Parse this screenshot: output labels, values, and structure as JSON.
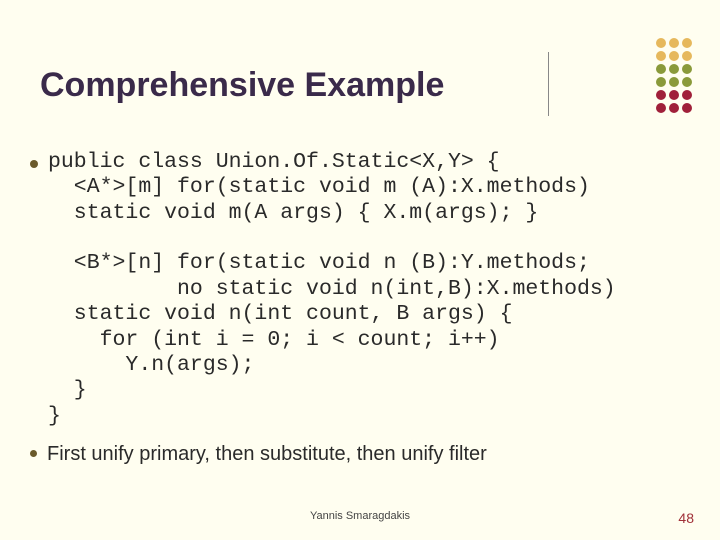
{
  "title": "Comprehensive Example",
  "code": "public class Union.Of.Static<X,Y> {\n  <A*>[m] for(static void m (A):X.methods)\n  static void m(A args) { X.m(args); }\n\n  <B*>[n] for(static void n (B):Y.methods;\n          no static void n(int,B):X.methods)\n  static void n(int count, B args) {\n    for (int i = 0; i < count; i++)\n      Y.n(args);\n  }\n}",
  "note": "First unify primary, then substitute, then unify filter",
  "footer": {
    "author": "Yannis Smaragdakis",
    "page": "48"
  }
}
